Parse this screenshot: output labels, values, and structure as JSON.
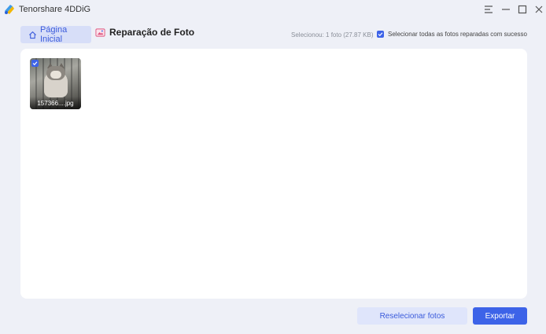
{
  "app": {
    "title": "Tenorshare 4DDiG"
  },
  "window_controls": {
    "menu": "menu-icon",
    "minimize": "minimize-icon",
    "maximize": "maximize-icon",
    "close": "close-icon"
  },
  "header": {
    "home_label": "Página Inicial",
    "section_title": "Reparação de Foto",
    "selected_info": "Selecionou: 1 foto (27.87 KB)",
    "select_all_label": "Selecionar todas as fotos reparadas com sucesso",
    "select_all_checked": true
  },
  "photos": [
    {
      "name": "157366....jpg",
      "checked": true
    }
  ],
  "footer": {
    "reselect_label": "Reselecionar fotos",
    "export_label": "Exportar"
  },
  "colors": {
    "accent": "#3d63e8",
    "background": "#eef0f7",
    "panel": "#ffffff"
  }
}
